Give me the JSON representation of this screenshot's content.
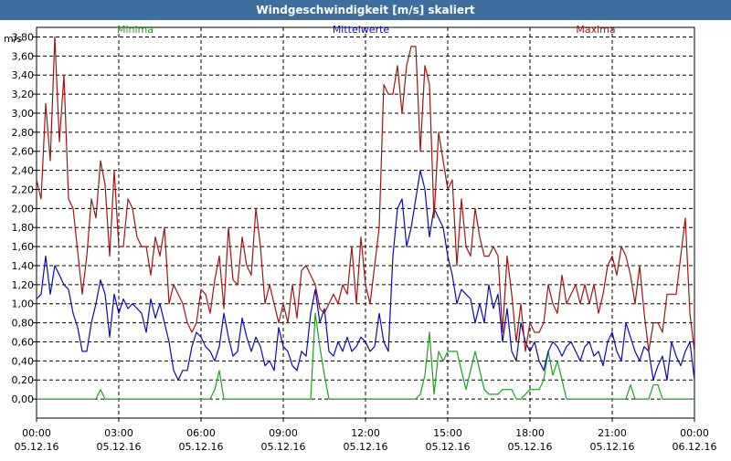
{
  "window": {
    "title": "Windgeschwindigkeit [m/s] skaliert"
  },
  "chart_data": {
    "type": "line",
    "title": "Windgeschwindigkeit [m/s] skaliert",
    "ylabel": "m/s",
    "xlabel": "",
    "ylim": [
      -0.2,
      3.9
    ],
    "xlim": [
      "2016-12-05 00:00",
      "2016-12-06 00:00"
    ],
    "grid": true,
    "legend": "top",
    "y_ticks": [
      "0,00",
      "0,20",
      "0,40",
      "0,60",
      "0,80",
      "1,00",
      "1,20",
      "1,40",
      "1,60",
      "1,80",
      "2,00",
      "2,20",
      "2,40",
      "2,60",
      "2,80",
      "3,00",
      "3,20",
      "3,40",
      "3,60",
      "3,80"
    ],
    "x_ticks": [
      {
        "time": "00:00",
        "date": "05.12.16"
      },
      {
        "time": "03:00",
        "date": "05.12.16"
      },
      {
        "time": "06:00",
        "date": "05.12.16"
      },
      {
        "time": "09:00",
        "date": "05.12.16"
      },
      {
        "time": "12:00",
        "date": "05.12.16"
      },
      {
        "time": "15:00",
        "date": "05.12.16"
      },
      {
        "time": "18:00",
        "date": "05.12.16"
      },
      {
        "time": "21:00",
        "date": "05.12.16"
      },
      {
        "time": "00:00",
        "date": "06.12.16"
      }
    ],
    "x_hours": [
      0,
      0.167,
      0.333,
      0.5,
      0.667,
      0.833,
      1,
      1.167,
      1.333,
      1.5,
      1.667,
      1.833,
      2,
      2.167,
      2.333,
      2.5,
      2.667,
      2.833,
      3,
      3.167,
      3.333,
      3.5,
      3.667,
      3.833,
      4,
      4.167,
      4.333,
      4.5,
      4.667,
      4.833,
      5,
      5.167,
      5.333,
      5.5,
      5.667,
      5.833,
      6,
      6.167,
      6.333,
      6.5,
      6.667,
      6.833,
      7,
      7.167,
      7.333,
      7.5,
      7.667,
      7.833,
      8,
      8.167,
      8.333,
      8.5,
      8.667,
      8.833,
      9,
      9.167,
      9.333,
      9.5,
      9.667,
      9.833,
      10,
      10.167,
      10.333,
      10.5,
      10.667,
      10.833,
      11,
      11.167,
      11.333,
      11.5,
      11.667,
      11.833,
      12,
      12.167,
      12.333,
      12.5,
      12.667,
      12.833,
      13,
      13.167,
      13.333,
      13.5,
      13.667,
      13.833,
      14,
      14.167,
      14.333,
      14.5,
      14.667,
      14.833,
      15,
      15.167,
      15.333,
      15.5,
      15.667,
      15.833,
      16,
      16.167,
      16.333,
      16.5,
      16.667,
      16.833,
      17,
      17.167,
      17.333,
      17.5,
      17.667,
      17.833,
      18,
      18.167,
      18.333,
      18.5,
      18.667,
      18.833,
      19,
      19.167,
      19.333,
      19.5,
      19.667,
      19.833,
      20,
      20.167,
      20.333,
      20.5,
      20.667,
      20.833,
      21,
      21.167,
      21.333,
      21.5,
      21.667,
      21.833,
      22,
      22.167,
      22.333,
      22.5,
      22.667,
      22.833,
      23,
      23.167,
      23.333,
      23.5,
      23.667,
      23.833,
      24
    ],
    "series": [
      {
        "name": "Minima",
        "color": "#1fa01f",
        "values": [
          0,
          0,
          0,
          0,
          0,
          0,
          0,
          0,
          0,
          0,
          0,
          0,
          0,
          0,
          0.1,
          0,
          0,
          0,
          0,
          0,
          0,
          0,
          0,
          0,
          0,
          0,
          0,
          0,
          0,
          0,
          0,
          0,
          0,
          0,
          0,
          0,
          0,
          0,
          0,
          0.1,
          0.3,
          0,
          0,
          0,
          0,
          0,
          0,
          0,
          0,
          0,
          0,
          0,
          0,
          0,
          0,
          0,
          0,
          0,
          0,
          0,
          0,
          0.9,
          0.55,
          0.25,
          0,
          0,
          0,
          0,
          0,
          0,
          0,
          0,
          0,
          0,
          0,
          0,
          0,
          0,
          0,
          0,
          0,
          0,
          0,
          0,
          0.05,
          0.25,
          0.7,
          0.05,
          0.5,
          0.4,
          0.5,
          0.5,
          0.5,
          0.3,
          0.1,
          0.3,
          0.5,
          0.3,
          0.1,
          0.05,
          0.05,
          0.05,
          0.1,
          0.1,
          0.1,
          0,
          0,
          0.05,
          0.1,
          0.1,
          0.1,
          0.2,
          0.5,
          0.25,
          0.4,
          0.2,
          0,
          0,
          0,
          0,
          0,
          0,
          0,
          0,
          0,
          0,
          0,
          0,
          0,
          0,
          0.15,
          0,
          0,
          0,
          0,
          0.15,
          0.15,
          0,
          0,
          0,
          0,
          0,
          0,
          0,
          0,
          0,
          0,
          0,
          0,
          0.1,
          0,
          0,
          0,
          0,
          0,
          0,
          0,
          0,
          0,
          0,
          0,
          0,
          0,
          0,
          0,
          0,
          0,
          0,
          0,
          0,
          0,
          0,
          0.1,
          0.05,
          0.2
        ]
      },
      {
        "name": "Mittelwerte",
        "color": "#0a0ab4",
        "values": [
          1.05,
          1.1,
          1.5,
          1.1,
          1.4,
          1.3,
          1.2,
          1.15,
          0.9,
          0.75,
          0.5,
          0.5,
          0.8,
          1.0,
          1.25,
          1.1,
          0.65,
          1.1,
          0.9,
          1.05,
          0.95,
          1.0,
          0.95,
          0.9,
          0.7,
          1.05,
          0.85,
          1.0,
          0.8,
          0.6,
          0.3,
          0.2,
          0.3,
          0.3,
          0.55,
          0.7,
          0.65,
          0.55,
          0.5,
          0.4,
          0.55,
          0.9,
          0.65,
          0.45,
          0.5,
          0.85,
          0.65,
          0.5,
          0.65,
          0.55,
          0.35,
          0.4,
          0.3,
          0.75,
          0.55,
          0.5,
          0.35,
          0.3,
          0.5,
          0.45,
          0.9,
          1.15,
          0.8,
          0.95,
          0.5,
          0.45,
          0.6,
          0.5,
          0.65,
          0.5,
          0.55,
          0.65,
          0.6,
          0.5,
          0.55,
          0.9,
          0.6,
          0.5,
          1.5,
          2.0,
          2.1,
          1.6,
          1.8,
          2.1,
          2.4,
          2.2,
          1.7,
          2.0,
          1.9,
          1.8,
          1.5,
          1.3,
          1.0,
          1.15,
          1.1,
          1.05,
          0.8,
          1.0,
          0.8,
          1.2,
          0.95,
          1.1,
          0.6,
          0.95,
          0.5,
          0.4,
          0.8,
          0.6,
          0.5,
          0.6,
          0.4,
          0.3,
          0.5,
          0.6,
          0.55,
          0.45,
          0.55,
          0.6,
          0.5,
          0.4,
          0.55,
          0.6,
          0.45,
          0.5,
          0.35,
          0.6,
          0.7,
          0.5,
          0.4,
          0.8,
          0.65,
          0.5,
          0.4,
          0.55,
          0.5,
          0.2,
          0.35,
          0.45,
          0.2,
          0.6,
          0.45,
          0.35,
          0.5,
          0.6,
          0.2,
          0.35,
          0.4,
          0.45,
          0.3,
          0.35,
          0.4,
          0.45,
          0.4,
          0.6,
          0.4,
          0.3,
          0.45,
          0.35,
          0.25,
          0.4,
          0.45,
          0.3,
          0.4,
          0.35,
          0.45,
          0.4,
          0.45,
          0.4,
          0.4,
          0.35,
          0.4
        ]
      },
      {
        "name": "Maxima",
        "color": "#a01414",
        "values": [
          2.3,
          2.1,
          3.1,
          2.5,
          3.8,
          2.7,
          3.4,
          2.1,
          2.0,
          1.55,
          1.1,
          1.5,
          2.1,
          1.9,
          2.5,
          2.25,
          1.5,
          2.4,
          1.6,
          1.6,
          2.1,
          2.0,
          1.7,
          1.6,
          1.6,
          1.3,
          1.7,
          1.5,
          1.8,
          1.0,
          1.2,
          1.1,
          1.0,
          0.8,
          0.7,
          0.8,
          1.15,
          1.1,
          0.9,
          1.25,
          1.5,
          0.95,
          1.8,
          1.25,
          1.2,
          1.7,
          1.4,
          1.3,
          2.0,
          1.6,
          1.0,
          1.2,
          1.0,
          0.8,
          1.0,
          0.8,
          1.2,
          0.85,
          1.35,
          1.4,
          1.3,
          1.2,
          0.95,
          0.9,
          1.0,
          1.1,
          1.0,
          1.2,
          1.1,
          1.6,
          1.0,
          1.7,
          1.2,
          1.0,
          1.4,
          1.8,
          3.3,
          3.2,
          3.2,
          3.5,
          3.0,
          3.5,
          3.7,
          3.7,
          2.6,
          3.5,
          3.3,
          1.9,
          2.8,
          2.5,
          2.2,
          2.3,
          1.4,
          2.1,
          1.6,
          1.5,
          2.0,
          1.7,
          1.5,
          1.5,
          1.6,
          1.5,
          0.7,
          1.5,
          1.1,
          0.6,
          1.0,
          0.5,
          0.8,
          0.7,
          0.7,
          0.8,
          1.2,
          1.0,
          0.9,
          1.3,
          1.0,
          1.1,
          1.2,
          1.0,
          1.2,
          1.0,
          1.2,
          0.9,
          1.1,
          1.4,
          1.5,
          1.3,
          1.6,
          1.5,
          1.3,
          1.0,
          1.4,
          0.9,
          0.5,
          0.8,
          0.8,
          0.7,
          1.1,
          1.1,
          1.1,
          1.5,
          1.9,
          0.9,
          0.5,
          0.8,
          0.7,
          1.0,
          0.8,
          0.7,
          0.6,
          0.9,
          0.8,
          0.7,
          0.8,
          0.9,
          0.8,
          0.7,
          0.8,
          0.7,
          0.75,
          0.8,
          0.7,
          0.8,
          0.7,
          0.9,
          0.8,
          0.75,
          0.6
        ]
      }
    ]
  }
}
